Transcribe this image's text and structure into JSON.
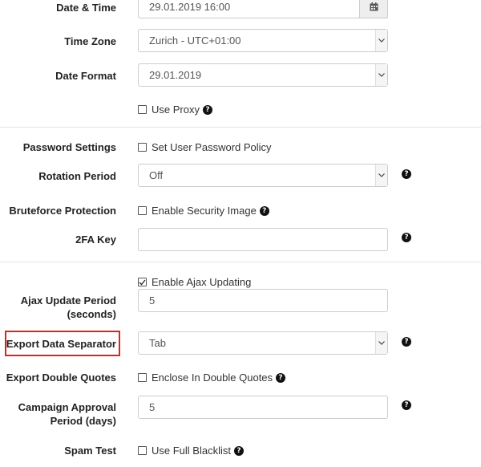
{
  "datetime": {
    "label": "Date & Time",
    "value": "29.01.2019 16:00",
    "icon": "calendar-icon"
  },
  "timezone": {
    "label": "Time Zone",
    "value": "Zurich - UTC+01:00"
  },
  "dateformat": {
    "label": "Date Format",
    "value": "29.01.2019"
  },
  "proxy": {
    "label": "Use Proxy",
    "checked": false
  },
  "password": {
    "label": "Password Settings",
    "checkbox_label": "Set User Password Policy",
    "checked": false
  },
  "rotation": {
    "label": "Rotation Period",
    "value": "Off"
  },
  "bruteforce": {
    "label": "Bruteforce Protection",
    "checkbox_label": "Enable Security Image",
    "checked": false
  },
  "twofa": {
    "label": "2FA Key",
    "value": ""
  },
  "ajax": {
    "checkbox_label": "Enable Ajax Updating",
    "checked": true,
    "label": "Ajax Update Period\n(seconds)",
    "value": "5"
  },
  "separator": {
    "label": "Export Data Separator",
    "value": "Tab",
    "highlight_color": "#e2231a"
  },
  "quotes": {
    "label": "Export Double Quotes",
    "checkbox_label": "Enclose In Double Quotes",
    "checked": false
  },
  "campaign": {
    "label": "Campaign Approval\nPeriod (days)",
    "value": "5"
  },
  "spam": {
    "label": "Spam Test",
    "checkbox_label": "Use Full Blacklist",
    "checked": false
  },
  "help_icon": "?"
}
